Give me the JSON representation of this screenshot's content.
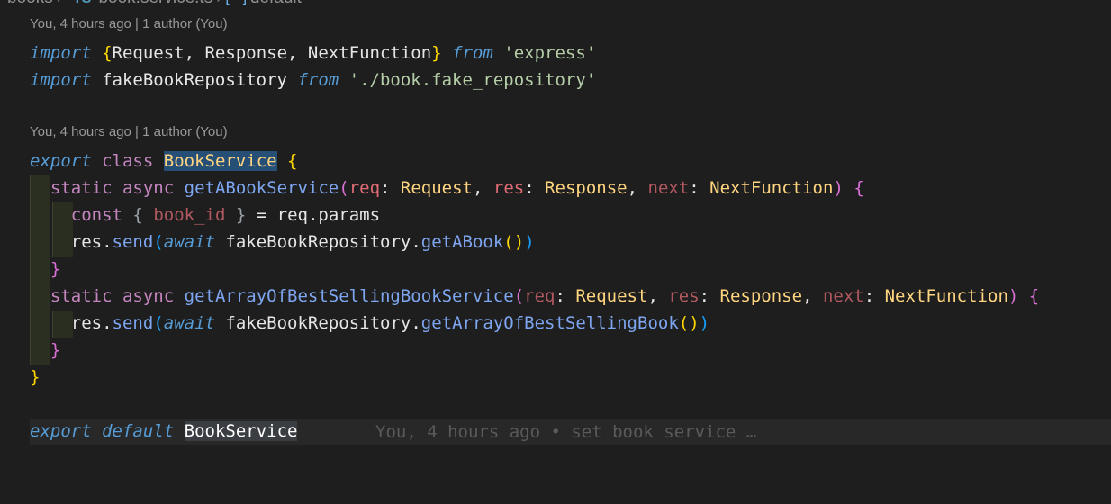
{
  "breadcrumb": {
    "folder": "books",
    "file": "book.service.ts",
    "symbol": "default"
  },
  "codelens": {
    "lens1": "You, 4 hours ago | 1 author (You)",
    "lens2": "You, 4 hours ago | 1 author (You)"
  },
  "code": {
    "l1": {
      "import": "import",
      "ob": "{",
      "names": "Request, Response, NextFunction",
      "cb": "}",
      "from": "from",
      "module": "'express'"
    },
    "l2": {
      "import": "import",
      "name": "fakeBookRepository",
      "from": "from",
      "module": "'./book.fake_repository'"
    },
    "l3": {
      "export": "export",
      "class": "class",
      "name": "BookService",
      "ob": "{"
    },
    "l4": {
      "static": "static",
      "async": "async",
      "fn": "getABookService",
      "op": "(",
      "p1": "req",
      "t1": "Request",
      "p2": "res",
      "t2": "Response",
      "p3": "next",
      "t3": "NextFunction",
      "cp": ")",
      "ob": "{"
    },
    "l5": {
      "const": "const",
      "ob": "{",
      "var": "book_id",
      "cb": "}",
      "rest": "= req.params"
    },
    "l6": {
      "obj": "res",
      "method": "send",
      "op": "(",
      "await": "await",
      "repo": "fakeBookRepository",
      "call": "getABook",
      "inner": "()",
      "cp": ")"
    },
    "l7": {
      "cb": "}"
    },
    "l8": {
      "static": "static",
      "async": "async",
      "fn": "getArrayOfBestSellingBookService",
      "op": "(",
      "p1": "req",
      "t1": "Request",
      "p2": "res",
      "t2": "Response",
      "p3": "next",
      "t3": "NextFunction",
      "cp": ")",
      "ob": "{"
    },
    "l9": {
      "obj": "res",
      "method": "send",
      "op": "(",
      "await": "await",
      "repo": "fakeBookRepository",
      "call": "getArrayOfBestSellingBook",
      "inner": "()",
      "cp": ")"
    },
    "l10": {
      "cb": "}"
    },
    "l11": {
      "cb": "}"
    },
    "l12": {
      "export": "export",
      "default": "default",
      "name": "BookService"
    }
  },
  "blame": "You, 4 hours ago • set book service …",
  "colors": {
    "background": "#1e1e1e",
    "keyword": "#569cd6",
    "control": "#c586c0",
    "string": "#ce9178",
    "function": "#61afef",
    "type": "#ffd580",
    "param": "#e06c75"
  }
}
